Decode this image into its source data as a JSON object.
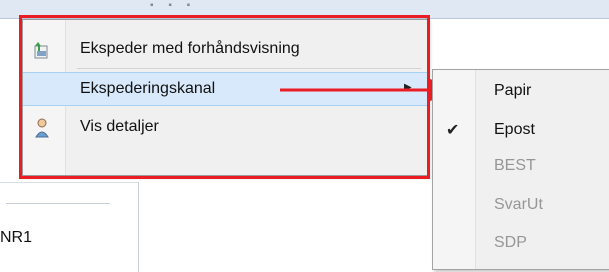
{
  "context_menu": {
    "items": [
      {
        "label": "Ekspeder med forhåndsvisning",
        "icon": "send-preview-icon"
      },
      {
        "label": "Ekspederingskanal",
        "icon": "",
        "has_submenu": true,
        "highlighted": true
      },
      {
        "label": "Vis detaljer",
        "icon": "person-icon"
      }
    ]
  },
  "submenu": {
    "items": [
      {
        "label": "Papir",
        "checked": false,
        "enabled": true
      },
      {
        "label": "Epost",
        "checked": true,
        "enabled": true
      },
      {
        "label": "BEST",
        "checked": false,
        "enabled": false
      },
      {
        "label": "SvarUt",
        "checked": false,
        "enabled": false
      },
      {
        "label": "SDP",
        "checked": false,
        "enabled": false
      }
    ]
  },
  "background": {
    "left_text": "NR1"
  },
  "annotation": {
    "color": "#ea1c24"
  },
  "colors": {
    "highlight": "#d7e9fb",
    "disabled_text": "#969696"
  }
}
